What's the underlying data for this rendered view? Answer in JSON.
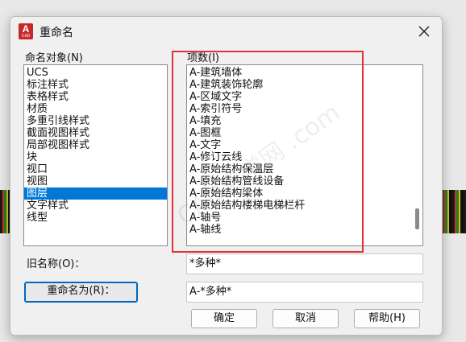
{
  "window": {
    "title": "重命名",
    "app_icon_letter": "A",
    "app_icon_sub": "CAD"
  },
  "left_panel": {
    "label": "命名对象(N)",
    "items": [
      "UCS",
      "标注样式",
      "表格样式",
      "材质",
      "多重引线样式",
      "截面视图样式",
      "局部视图样式",
      "块",
      "视口",
      "视图",
      "图层",
      "文字样式",
      "线型"
    ],
    "selected_index": 10
  },
  "right_panel": {
    "label": "项数(I)",
    "items": [
      "A-建筑墙体",
      "A-建筑装饰轮廓",
      "A-区域文字",
      "A-索引符号",
      "A-填充",
      "A-图框",
      "A-文字",
      "A-修订云线",
      "A-原始结构保温层",
      "A-原始结构管线设备",
      "A-原始结构梁体",
      "A-原始结构楼梯电梯栏杆",
      "A-轴号",
      "A-轴线"
    ]
  },
  "old_name": {
    "label": "旧名称(O)：",
    "value": "*多种*"
  },
  "rename_to": {
    "button_label": "重命名为(R)：",
    "value": "A-*多种*"
  },
  "buttons": {
    "ok": "确定",
    "cancel": "取消",
    "help": "帮助(H)"
  },
  "watermark": "CAD自学网 .com",
  "colors": {
    "selection": "#0078d7",
    "highlight_rect": "#e0323c",
    "default_button_border": "#0067c0",
    "app_icon": "#c62828"
  }
}
